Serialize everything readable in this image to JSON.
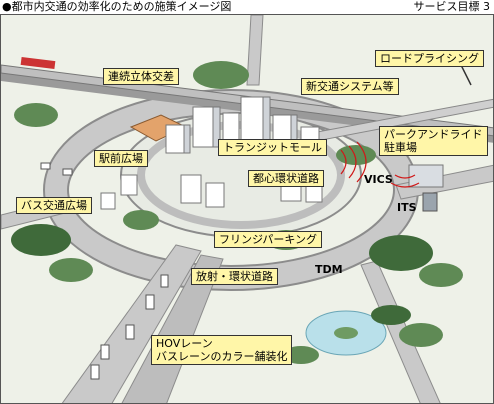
{
  "header": {
    "bullet": "●",
    "title": "都市内交通の効率化のための施策イメージ図",
    "goal_label": "サービス目標 3"
  },
  "callouts": {
    "renzoku": "連続立体交差",
    "road_pricing": "ロードプライシング",
    "shin_kotsu": "新交通システム等",
    "park_ride_1": "パークアンドライド",
    "park_ride_2": "駐車場",
    "eki_mae": "駅前広場",
    "transit_mall": "トランジットモール",
    "toshin": "都心環状道路",
    "bus_kotsu": "バス交通広場",
    "fringe": "フリンジパーキング",
    "hoshajo": "放射・環状道路",
    "hov_1": "HOVレーン",
    "hov_2": "バスレーンのカラー舗装化"
  },
  "labels": {
    "vics": "VICS",
    "its": "ITS",
    "tdm": "TDM"
  },
  "colors": {
    "ground": "#eef1e8",
    "road": "#c9c9c9",
    "road_edge": "#8c8c8c",
    "tree": "#5f8a55",
    "tree_dark": "#3f6a3a",
    "building": "#ffffff",
    "building_shade": "#cfd3d8",
    "callout_bg": "#fff6a8",
    "signal_red": "#d01818",
    "train": "#cc3333",
    "plaza": "#e3a36b",
    "lake": "#b9e0ea"
  }
}
